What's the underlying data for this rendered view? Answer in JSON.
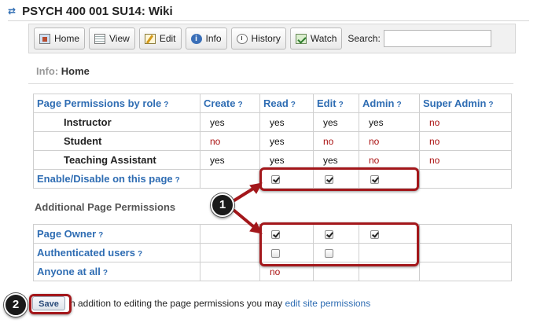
{
  "header": {
    "title": "PSYCH 400 001 SU14: Wiki",
    "icon": "tool-arrows-icon"
  },
  "toolbar": {
    "buttons": [
      {
        "label": "Home",
        "icon": "home-icon"
      },
      {
        "label": "View",
        "icon": "view-icon"
      },
      {
        "label": "Edit",
        "icon": "edit-icon"
      },
      {
        "label": "Info",
        "icon": "info-icon"
      },
      {
        "label": "History",
        "icon": "history-icon"
      },
      {
        "label": "Watch",
        "icon": "watch-icon"
      }
    ],
    "search_label": "Search:",
    "search_value": ""
  },
  "info": {
    "label": "Info:",
    "page": "Home"
  },
  "permissions": {
    "headers": [
      "Page Permissions by role",
      "Create",
      "Read",
      "Edit",
      "Admin",
      "Super Admin"
    ],
    "help": "?",
    "roles": [
      {
        "name": "Instructor",
        "values": [
          "yes",
          "yes",
          "yes",
          "yes",
          "no"
        ]
      },
      {
        "name": "Student",
        "values": [
          "no",
          "yes",
          "no",
          "no",
          "no"
        ]
      },
      {
        "name": "Teaching Assistant",
        "values": [
          "yes",
          "yes",
          "yes",
          "no",
          "no"
        ]
      }
    ],
    "enable_label": "Enable/Disable on this page",
    "enable_checks": {
      "read": true,
      "edit": true,
      "admin": true
    }
  },
  "additional": {
    "title": "Additional Page Permissions",
    "rows": [
      {
        "label": "Page Owner",
        "read": true,
        "edit": true,
        "admin": true
      },
      {
        "label": "Authenticated users",
        "read": false,
        "edit": false
      },
      {
        "label": "Anyone at all",
        "read_text": "no"
      }
    ]
  },
  "footer": {
    "save_label": "Save",
    "text": "n addition to editing the page permissions you may",
    "link": "edit site permissions"
  },
  "callouts": {
    "marker1": "1",
    "marker2": "2",
    "color": "#a3171b"
  },
  "colors": {
    "link": "#2f6db3",
    "no": "#a11111"
  }
}
